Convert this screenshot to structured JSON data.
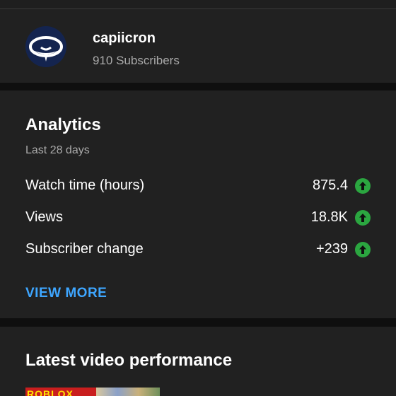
{
  "channel": {
    "name": "capiicron",
    "subscribers": "910 Subscribers"
  },
  "analytics": {
    "title": "Analytics",
    "period": "Last 28 days",
    "metrics": [
      {
        "label": "Watch time (hours)",
        "value": "875.4",
        "trend": "up"
      },
      {
        "label": "Views",
        "value": "18.8K",
        "trend": "up"
      },
      {
        "label": "Subscriber change",
        "value": "+239",
        "trend": "up"
      }
    ],
    "view_more": "VIEW MORE"
  },
  "latest": {
    "title": "Latest video performance",
    "thumbnail_text": "ROBLOX"
  },
  "colors": {
    "background": "#0f0f0f",
    "card": "#212121",
    "accent_link": "#3ea6ff",
    "trend_up": "#2ba640",
    "avatar_bg": "#14244f"
  },
  "icons": {
    "trend": "arrow-up-circle-icon"
  }
}
